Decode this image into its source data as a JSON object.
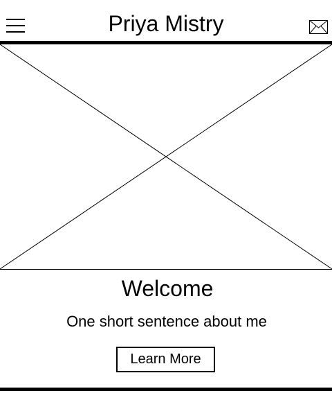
{
  "header": {
    "title": "Priya Mistry",
    "menu_icon": "hamburger-menu-icon",
    "mail_icon": "envelope-icon"
  },
  "hero": {
    "image_placeholder": "image-placeholder"
  },
  "main": {
    "heading": "Welcome",
    "tagline": "One short sentence about me",
    "cta_label": "Learn More"
  },
  "colors": {
    "foreground": "#000000",
    "background": "#ffffff"
  }
}
